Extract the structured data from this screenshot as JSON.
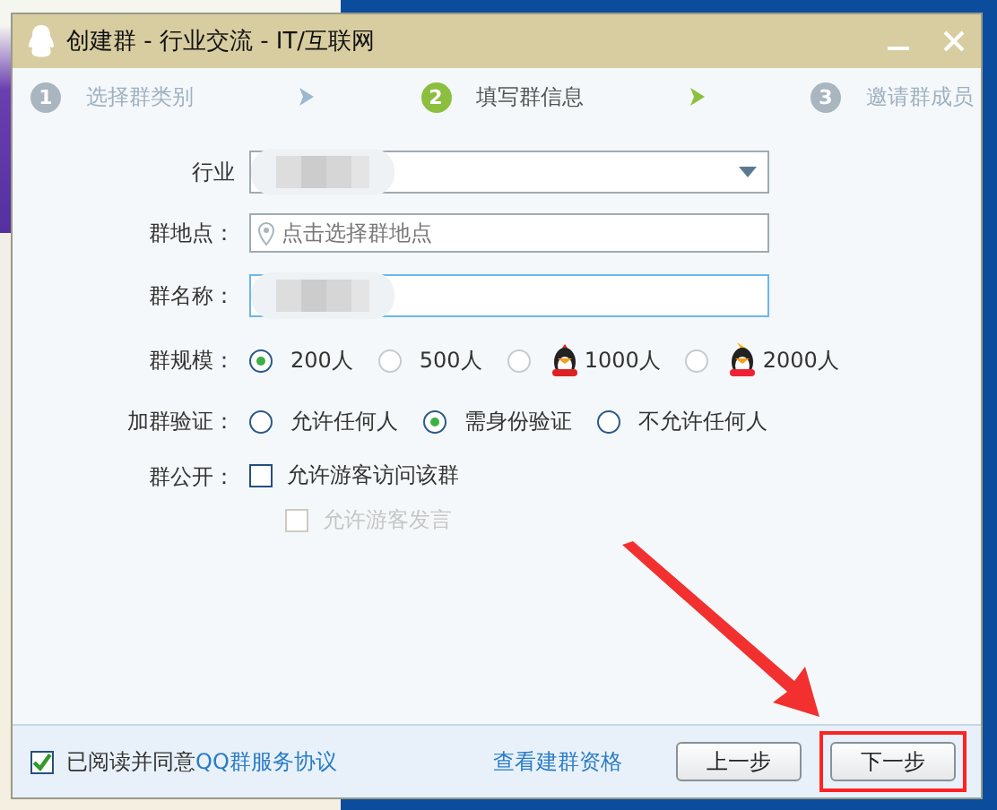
{
  "window": {
    "title": "创建群 - 行业交流 - IT/互联网"
  },
  "steps": [
    {
      "number": "1",
      "label": "选择群类别",
      "selected": false
    },
    {
      "number": "2",
      "label": "填写群信息",
      "selected": true
    },
    {
      "number": "3",
      "label": "邀请群成员",
      "selected": false
    }
  ],
  "form": {
    "industry": {
      "label": "行业"
    },
    "location": {
      "label": "群地点：",
      "placeholder": "点击选择群地点"
    },
    "name": {
      "label": "群名称："
    },
    "size": {
      "label": "群规模：",
      "options": [
        {
          "label": "200人",
          "selected": true,
          "kind": "plain"
        },
        {
          "label": "500人",
          "selected": false,
          "kind": "plain"
        },
        {
          "label": "1000人",
          "selected": false,
          "kind": "premium"
        },
        {
          "label": "2000人",
          "selected": false,
          "kind": "super"
        }
      ]
    },
    "verify": {
      "label": "加群验证：",
      "options": [
        {
          "label": "允许任何人",
          "selected": false
        },
        {
          "label": "需身份验证",
          "selected": true
        },
        {
          "label": "不允许任何人",
          "selected": false
        }
      ]
    },
    "public": {
      "label": "群公开：",
      "options": [
        {
          "label": "允许游客访问该群",
          "checked": false,
          "disabled": false
        },
        {
          "label": "允许游客发言",
          "checked": false,
          "disabled": true
        }
      ]
    }
  },
  "footer": {
    "agree": {
      "checked": true,
      "text": "已阅读并同意",
      "link": "QQ群服务协议"
    },
    "qualification_link": "查看建群资格",
    "buttons": [
      {
        "label": "上一步",
        "highlighted": false
      },
      {
        "label": "下一步",
        "highlighted": true
      }
    ]
  }
}
